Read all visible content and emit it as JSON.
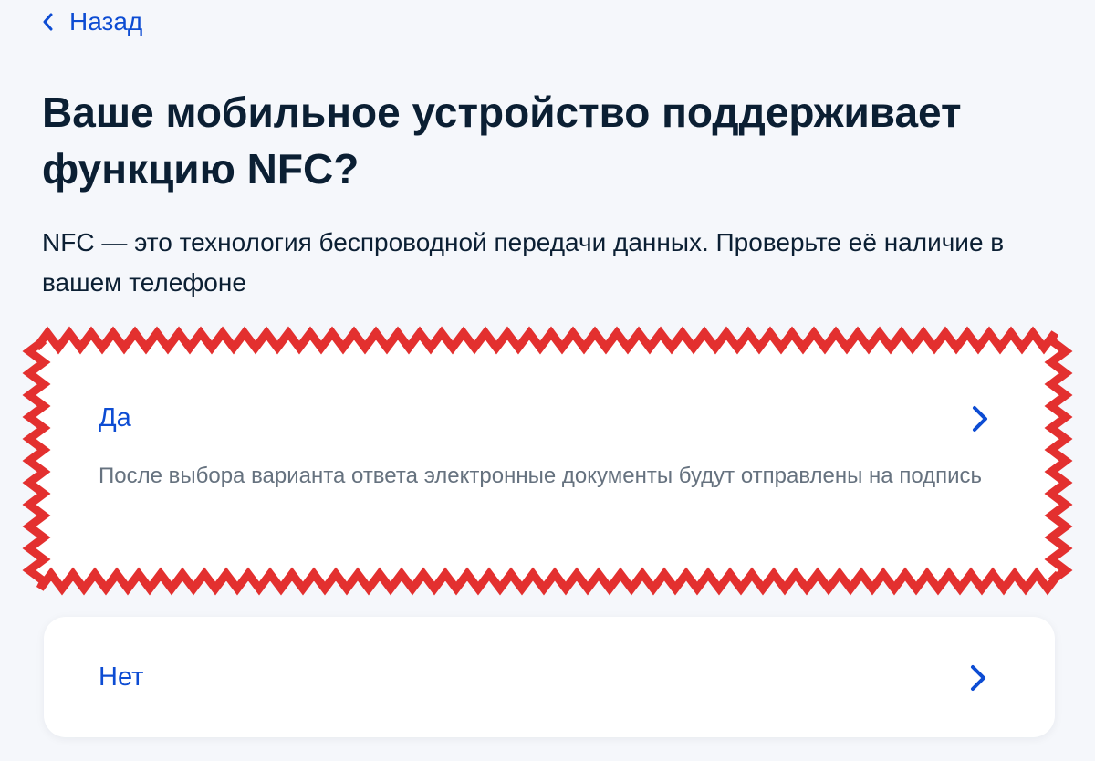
{
  "navigation": {
    "back_label": "Назад",
    "back_icon": "chevron-left-icon"
  },
  "question": {
    "title": "Ваше мобильное устройство поддерживает функцию NFC?",
    "description": "NFC — это технология беспроводной передачи данных. Проверьте её наличие в вашем телефоне"
  },
  "options": [
    {
      "label": "Да",
      "hint": "После выбора варианта ответа электронные документы будут отправлены на подпись",
      "icon": "chevron-right-icon",
      "highlighted": true
    },
    {
      "label": "Нет",
      "icon": "chevron-right-icon",
      "highlighted": false
    }
  ],
  "colors": {
    "background": "#f5f7fb",
    "card": "#ffffff",
    "accent": "#0d4cd3",
    "text": "#0b1f33",
    "hint_text": "#66727f",
    "highlight_border": "#e3302f"
  }
}
